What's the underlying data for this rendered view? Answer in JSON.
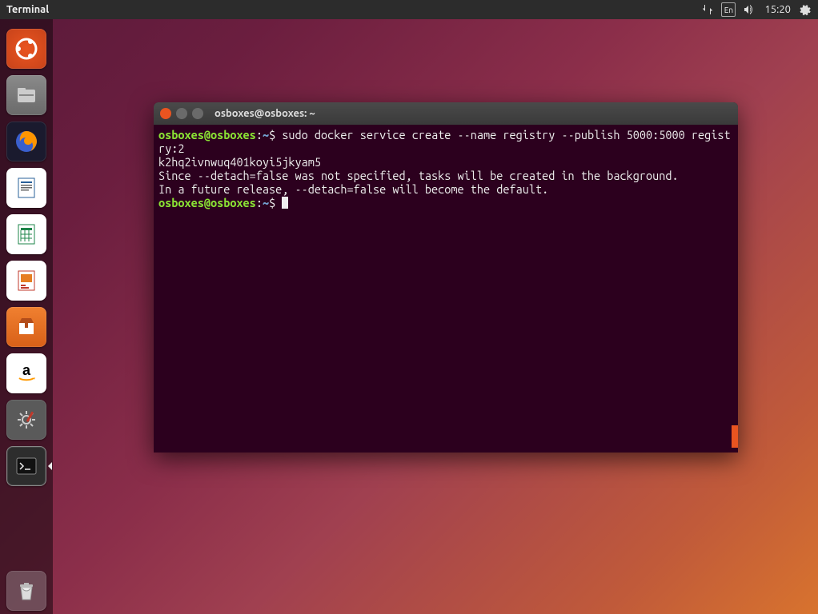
{
  "menubar": {
    "app_label": "Terminal",
    "lang_indicator": "En",
    "clock": "15:20"
  },
  "launcher": {
    "items": [
      {
        "name": "dash",
        "icon": "ubuntu-icon"
      },
      {
        "name": "files",
        "icon": "files-icon"
      },
      {
        "name": "firefox",
        "icon": "firefox-icon"
      },
      {
        "name": "writer",
        "icon": "writer-icon"
      },
      {
        "name": "calc",
        "icon": "calc-icon"
      },
      {
        "name": "impress",
        "icon": "impress-icon"
      },
      {
        "name": "software",
        "icon": "software-icon"
      },
      {
        "name": "amazon",
        "icon": "amazon-icon"
      },
      {
        "name": "settings",
        "icon": "settings-icon"
      },
      {
        "name": "terminal",
        "icon": "terminal-icon",
        "active": true
      }
    ],
    "trash": {
      "name": "trash",
      "icon": "trash-icon"
    }
  },
  "terminal": {
    "title": "osboxes@osboxes: ~",
    "prompt_user": "osboxes@osboxes",
    "prompt_sep": ":",
    "prompt_path": "~",
    "prompt_symbol": "$",
    "command1": "sudo docker service create --name registry --publish 5000:5000 registry:2",
    "output1": "k2hq2ivnwuq401koyi5jkyam5",
    "output2": "Since --detach=false was not specified, tasks will be created in the background.",
    "output3": "In a future release, --detach=false will become the default."
  }
}
